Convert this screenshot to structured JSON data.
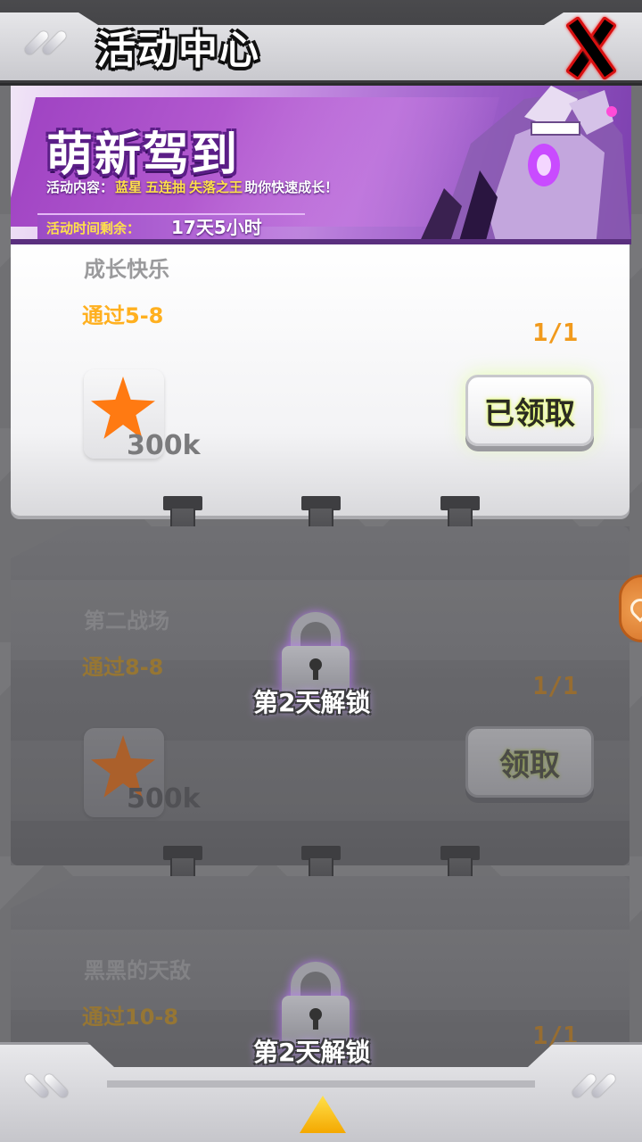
{
  "header": {
    "title": "活动中心",
    "close_label": "X"
  },
  "banner": {
    "headline": "萌新驾到",
    "content_prefix": "活动内容：",
    "content_highlights": [
      "蓝星",
      "五连抽",
      "失落之王"
    ],
    "content_suffix": "助你快速成长！",
    "time_label": "活动时间剩余：",
    "time_value": "17天5小时"
  },
  "tasks": [
    {
      "name": "成长快乐",
      "condition": "通过5-8",
      "progress": "1/1",
      "reward_icon": "star-icon",
      "reward_amount": "300k",
      "button_label": "已领取",
      "locked": false
    },
    {
      "name": "第二战场",
      "condition": "通过8-8",
      "progress": "1/1",
      "reward_icon": "star-icon",
      "reward_amount": "500k",
      "button_label": "领取",
      "locked": true,
      "lock_text": "第2天解锁"
    },
    {
      "name": "黑黑的天敌",
      "condition": "通过10-8",
      "progress": "1/1",
      "locked": true,
      "lock_text": "第2天解锁"
    }
  ],
  "colors": {
    "accent_yellow": "#ffb01f",
    "banner_purple": "#a044c3",
    "close_red": "#d61010",
    "button_glow": "#e8ff6a"
  },
  "icons": {
    "close": "close-icon",
    "reward": "star-icon",
    "lock": "lock-icon",
    "scroll": "up-arrow-icon",
    "side": "heart-icon"
  }
}
